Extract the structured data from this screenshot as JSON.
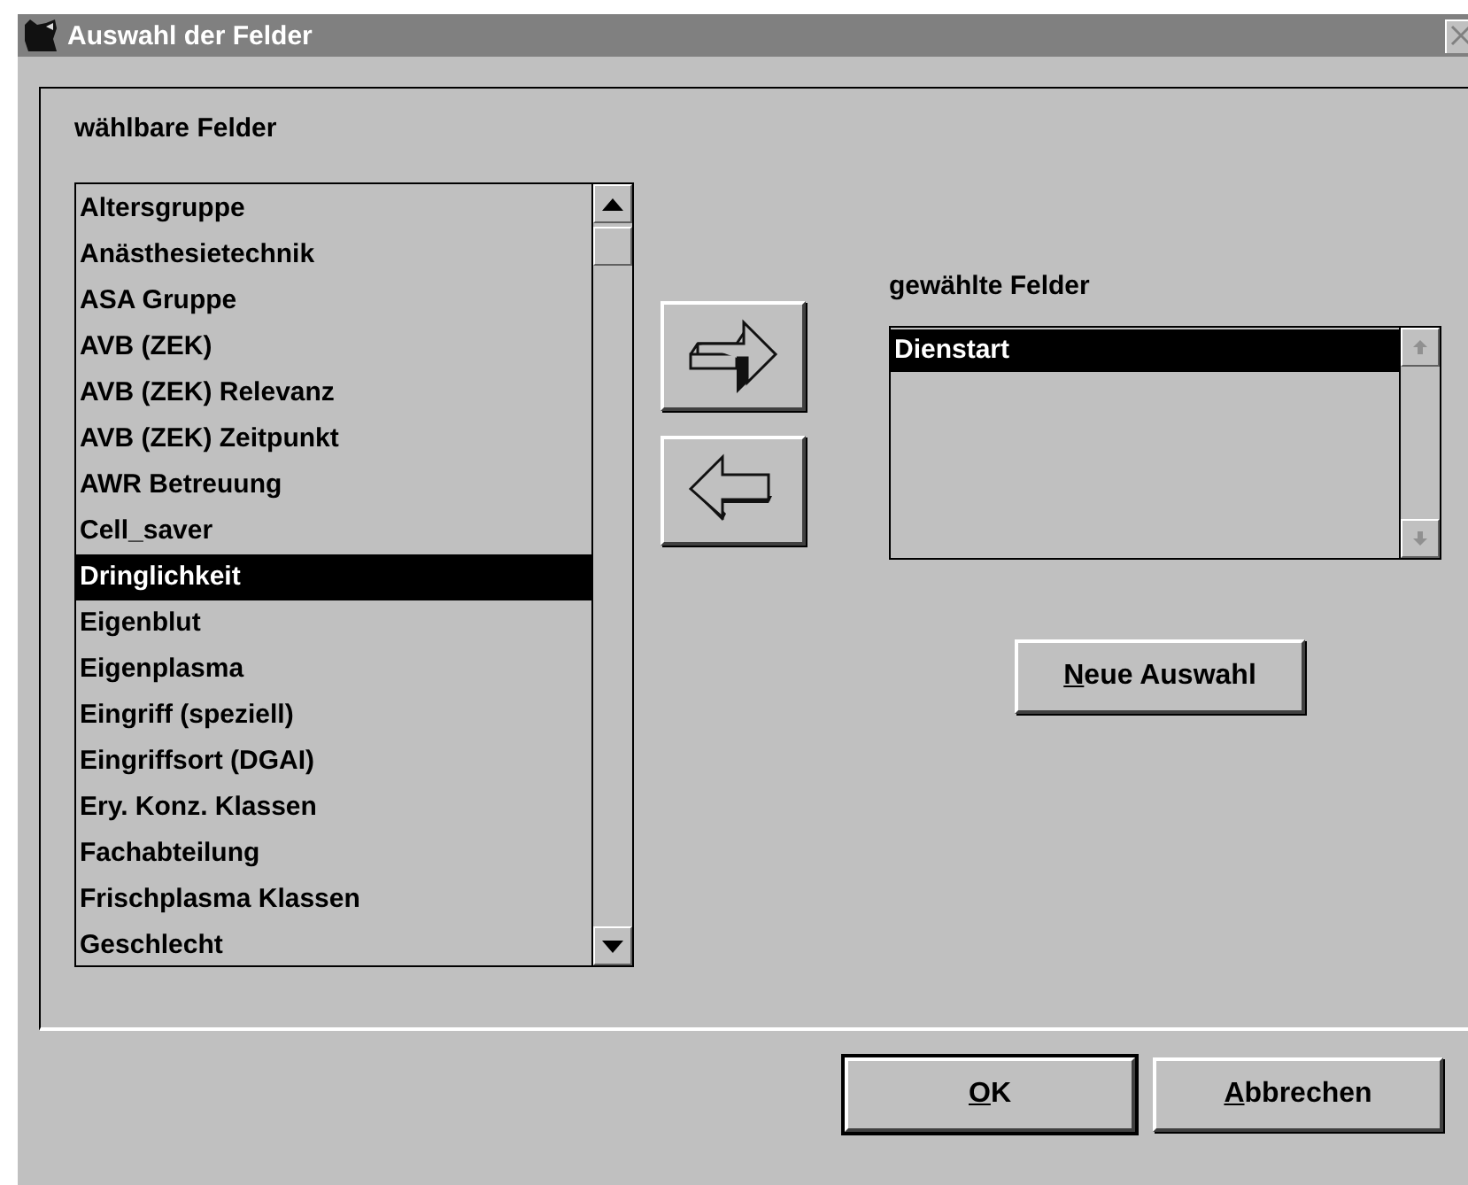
{
  "window": {
    "title": "Auswahl der Felder"
  },
  "available": {
    "label": "wählbare Felder",
    "items": [
      {
        "label": "Altersgruppe",
        "selected": false
      },
      {
        "label": "Anästhesietechnik",
        "selected": false
      },
      {
        "label": "ASA Gruppe",
        "selected": false
      },
      {
        "label": "AVB (ZEK)",
        "selected": false
      },
      {
        "label": "AVB (ZEK) Relevanz",
        "selected": false
      },
      {
        "label": "AVB (ZEK) Zeitpunkt",
        "selected": false
      },
      {
        "label": "AWR Betreuung",
        "selected": false
      },
      {
        "label": "Cell_saver",
        "selected": false
      },
      {
        "label": "Dringlichkeit",
        "selected": true
      },
      {
        "label": "Eigenblut",
        "selected": false
      },
      {
        "label": "Eigenplasma",
        "selected": false
      },
      {
        "label": "Eingriff (speziell)",
        "selected": false
      },
      {
        "label": "Eingriffsort (DGAI)",
        "selected": false
      },
      {
        "label": "Ery. Konz. Klassen",
        "selected": false
      },
      {
        "label": "Fachabteilung",
        "selected": false
      },
      {
        "label": "Frischplasma Klassen",
        "selected": false
      },
      {
        "label": "Geschlecht",
        "selected": false
      }
    ]
  },
  "chosen": {
    "label": "gewählte Felder",
    "items": [
      {
        "label": "Dienstart",
        "selected": true
      }
    ]
  },
  "new_selection_button": {
    "accel": "N",
    "rest": "eue Auswahl"
  },
  "buttons": [
    {
      "accel": "O",
      "rest": "K",
      "default": true
    },
    {
      "accel": "A",
      "rest": "bbrechen",
      "default": false
    }
  ]
}
